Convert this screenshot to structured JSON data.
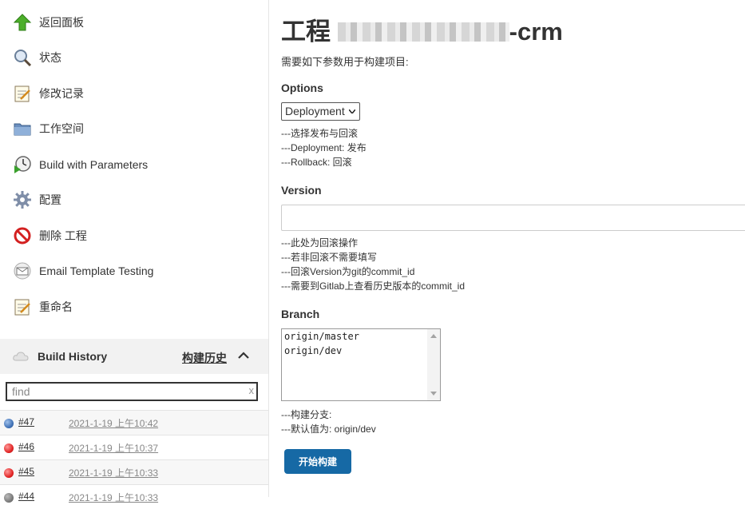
{
  "sidebar": {
    "tasks": [
      {
        "label": "返回面板",
        "icon": "up-arrow-icon"
      },
      {
        "label": "状态",
        "icon": "search-icon"
      },
      {
        "label": "修改记录",
        "icon": "notepad-icon"
      },
      {
        "label": "工作空间",
        "icon": "folder-icon"
      },
      {
        "label": "Build with Parameters",
        "icon": "clock-play-icon"
      },
      {
        "label": "配置",
        "icon": "gear-icon"
      },
      {
        "label": "删除 工程",
        "icon": "no-entry-icon"
      },
      {
        "label": "Email Template Testing",
        "icon": "envelope-icon"
      },
      {
        "label": "重命名",
        "icon": "notepad-icon"
      }
    ]
  },
  "build_history": {
    "title": "Build History",
    "trend_link": "构建历史",
    "search_placeholder": "find",
    "clear": "x",
    "builds": [
      {
        "number": "#47",
        "time": "2021-1-19 上午10:42",
        "status": "blue"
      },
      {
        "number": "#46",
        "time": "2021-1-19 上午10:37",
        "status": "red"
      },
      {
        "number": "#45",
        "time": "2021-1-19 上午10:33",
        "status": "red"
      },
      {
        "number": "#44",
        "time": "2021-1-19 上午10:33",
        "status": "grey"
      }
    ]
  },
  "main": {
    "title_prefix": "工程",
    "title_suffix": "-crm",
    "description": "需要如下参数用于构建项目:",
    "params": {
      "options": {
        "label": "Options",
        "selected": "Deployment",
        "help": [
          "---选择发布与回滚",
          "---Deployment: 发布",
          "---Rollback: 回滚"
        ]
      },
      "version": {
        "label": "Version",
        "value": "",
        "help": [
          "---此处为回滚操作",
          "---若非回滚不需要填写",
          "---回滚Version为git的commit_id",
          "---需要到Gitlab上查看历史版本的commit_id"
        ]
      },
      "branch": {
        "label": "Branch",
        "options": [
          "origin/master",
          "origin/dev"
        ],
        "help": [
          "---构建分支:",
          "---默认值为: origin/dev"
        ]
      }
    },
    "build_button": "开始构建"
  },
  "colors": {
    "build_button": "#1669a5",
    "status_blue": "#3d6fb4",
    "status_red": "#e02020",
    "status_grey": "#777777"
  }
}
